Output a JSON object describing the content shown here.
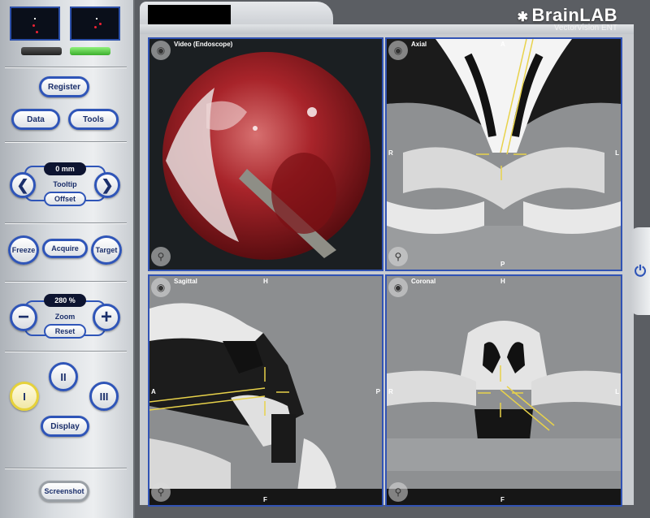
{
  "panel": {
    "buttons": {
      "register": "Register",
      "data": "Data",
      "tools": "Tools",
      "freeze": "Freeze",
      "acquire": "Acquire",
      "target": "Target",
      "display": "Display",
      "screenshot": "Screenshot"
    },
    "tooltip": {
      "value": "0 mm",
      "label": "Tooltip",
      "offset": "Offset"
    },
    "zoom": {
      "value": "280 %",
      "label": "Zoom",
      "reset": "Reset"
    },
    "layouts": [
      "I",
      "II",
      "III"
    ],
    "status_colors": [
      "#2a2c2e",
      "#4cc83c"
    ]
  },
  "brand": {
    "name": "BrainLAB",
    "product": "VectorVision ENT"
  },
  "views": {
    "video": {
      "label": "Video (Endoscope)"
    },
    "axial": {
      "label": "Axial",
      "top": "A",
      "bottom": "P",
      "left": "R",
      "right": "L"
    },
    "sagittal": {
      "label": "Sagittal",
      "top": "H",
      "bottom": "F",
      "left": "A",
      "right": "P"
    },
    "coronal": {
      "label": "Coronal",
      "top": "H",
      "bottom": "F",
      "left": "R",
      "right": "L"
    }
  },
  "colors": {
    "accent": "#3153b4",
    "crosshair": "#e8d24a"
  },
  "icons": {
    "eye": "eye-icon",
    "zoom": "magnifier-icon",
    "power": "power-icon"
  }
}
